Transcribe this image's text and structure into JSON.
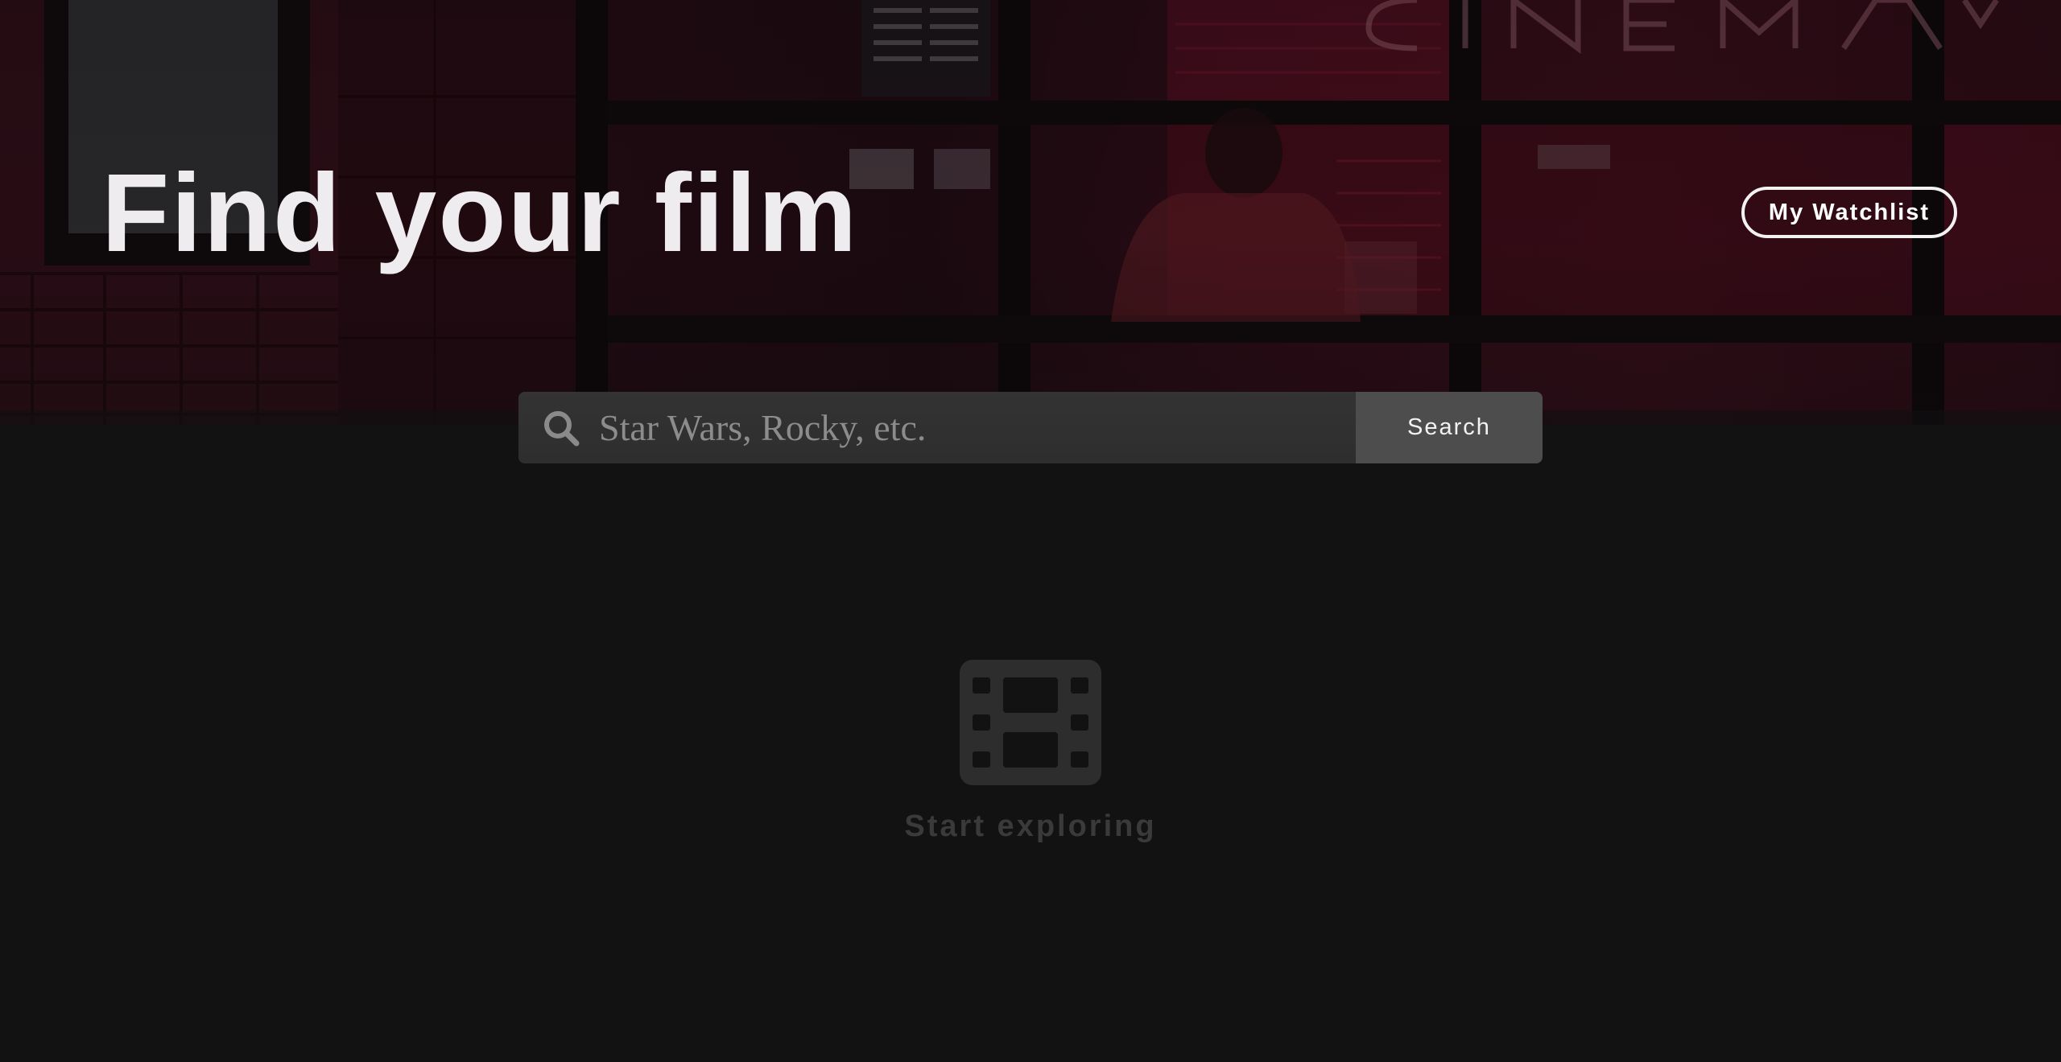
{
  "hero": {
    "title": "Find your film",
    "background_image": "cinema-lobby-photo",
    "watchlist_label": "My Watchlist"
  },
  "search": {
    "icon": "search-icon",
    "placeholder": "Star Wars, Rocky, etc.",
    "value": "",
    "button_label": "Search"
  },
  "empty_state": {
    "icon": "film-icon",
    "label": "Start exploring"
  },
  "colors": {
    "page_background": "#121212",
    "hero_tint": "#2a0a13",
    "search_field": "#303030",
    "search_button": "#4d4d4d",
    "empty_state": "#3a3a3a",
    "title_text": "#efecef"
  }
}
